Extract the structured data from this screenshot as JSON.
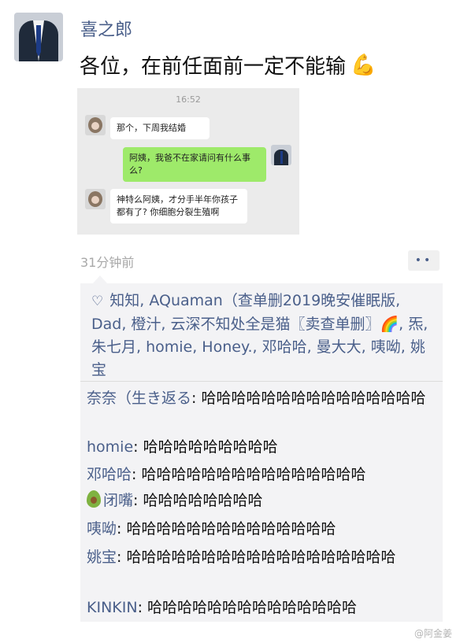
{
  "post": {
    "poster_name": "喜之郎",
    "text": "各位，在前任面前一定不能输",
    "emoji": "💪",
    "time_ago": "31分钟前",
    "more_label": "••"
  },
  "chat_screenshot": {
    "time": "16:52",
    "messages": [
      {
        "side": "left",
        "text": "那个，下周我结婚"
      },
      {
        "side": "right",
        "text": "阿姨，我爸不在家请问有什么事么?"
      },
      {
        "side": "left",
        "text": "神特么阿姨，才分手半年你孩子都有了? 你细胞分裂生殖啊"
      }
    ]
  },
  "likes": {
    "text": "知知, AQuaman（查单删2019晚安催眠版, Dad, 橙汁, 云深不知处全是猫〖卖查单删〗🌈, 炁, 朱七月, homie, Honey., 邓哈哈, 曼大大, 咦呦, 姚宝"
  },
  "comments": [
    {
      "name": "奈奈（生き返る",
      "text": "哈哈哈哈哈哈哈哈哈哈哈哈哈哈哈"
    },
    {
      "name": "homie",
      "text": "哈哈哈哈哈哈哈哈哈"
    },
    {
      "name": "邓哈哈",
      "text": "哈哈哈哈哈哈哈哈哈哈哈哈哈哈哈"
    },
    {
      "name": "闭嘴",
      "text": "哈哈哈哈哈哈哈哈"
    },
    {
      "name": "咦呦",
      "text": "哈哈哈哈哈哈哈哈哈哈哈哈哈哈"
    },
    {
      "name": "姚宝",
      "text": "哈哈哈哈哈哈哈哈哈哈哈哈哈哈哈哈哈哈"
    },
    {
      "name": "KINKIN",
      "text": "哈哈哈哈哈哈哈哈哈哈哈哈哈哈"
    }
  ],
  "watermark": "@阿金姜"
}
